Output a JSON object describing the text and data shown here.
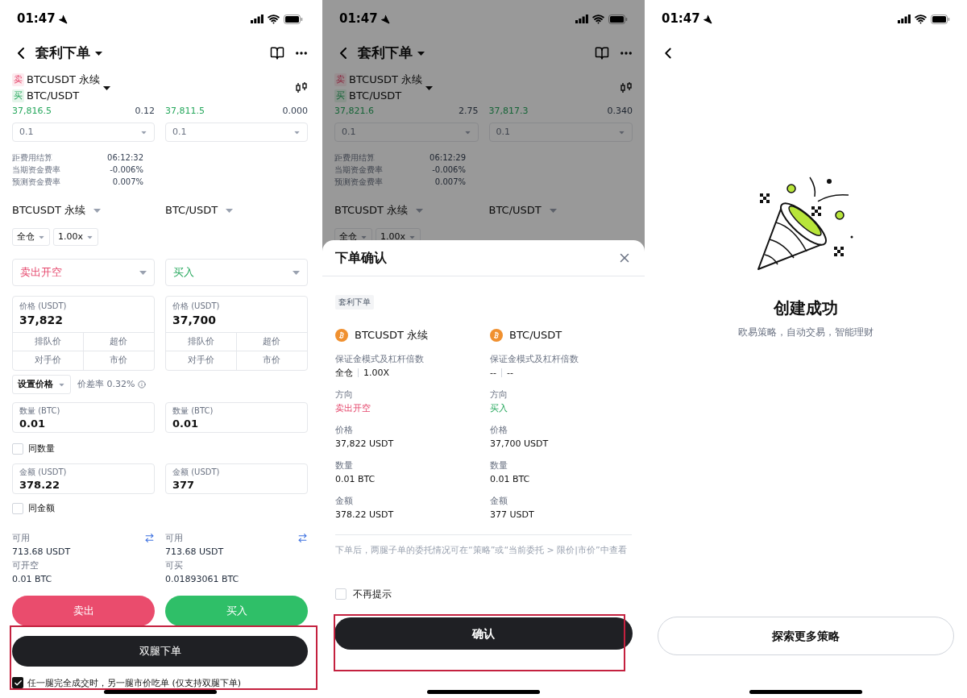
{
  "screens": [
    {
      "kind": "order",
      "time": "01:47",
      "title": "套利下单",
      "pairs": [
        {
          "tag": "卖",
          "name": "BTCUSDT 永续",
          "kind": "sell"
        },
        {
          "tag": "买",
          "name": "BTC/USDT",
          "kind": "buy"
        }
      ],
      "book": [
        {
          "price": "37,816.5",
          "size": "0.12",
          "step": "0.1"
        },
        {
          "price": "37,811.5",
          "size": "0.000",
          "step": "0.1"
        }
      ],
      "funding": [
        {
          "label": "距费用结算",
          "value": "06:12:32"
        },
        {
          "label": "当期资金费率",
          "value": "-0.006%"
        },
        {
          "label": "预测资金费率",
          "value": "0.007%"
        }
      ],
      "instruments": [
        "BTCUSDT 永续",
        "BTC/USDT"
      ],
      "margin": {
        "mode": "全仓",
        "leverage": "1.00x"
      },
      "legs": [
        {
          "kind": "sell",
          "direction": "卖出开空",
          "price_label": "价格 (USDT)",
          "price": "37,822",
          "price_options": [
            "排队价",
            "超价",
            "对手价",
            "市价"
          ],
          "qty_label": "数量 (BTC)",
          "qty": "0.01",
          "amount_label": "金额 (USDT)",
          "amount": "378.22",
          "available_label": "可用",
          "available": "713.68 USDT",
          "max_label": "可开空",
          "max": "0.01 BTC",
          "button": "卖出"
        },
        {
          "kind": "buy",
          "direction": "买入",
          "price_label": "价格 (USDT)",
          "price": "37,700",
          "price_options": [
            "排队价",
            "超价",
            "对手价",
            "市价"
          ],
          "qty_label": "数量 (BTC)",
          "qty": "0.01",
          "amount_label": "金额 (USDT)",
          "amount": "377",
          "available_label": "可用",
          "available": "713.68 USDT",
          "max_label": "可买",
          "max": "0.01893061 BTC",
          "button": "买入"
        }
      ],
      "price_mode": "设置价格",
      "spread": "价差率 0.32%",
      "same_qty": {
        "label": "同数量",
        "checked": false
      },
      "same_amount": {
        "label": "同金额",
        "checked": false
      },
      "submit": "双腿下单",
      "auto_taker": {
        "label": "任一腿完全成交时，另一腿市价吃单 (仅支持双腿下单)",
        "checked": true
      }
    },
    {
      "kind": "confirm",
      "time": "01:47",
      "title": "套利下单",
      "pairs": [
        {
          "tag": "卖",
          "name": "BTCUSDT 永续",
          "kind": "sell"
        },
        {
          "tag": "买",
          "name": "BTC/USDT",
          "kind": "buy"
        }
      ],
      "book": [
        {
          "price": "37,821.6",
          "size": "2.75",
          "step": "0.1"
        },
        {
          "price": "37,817.3",
          "size": "0.340",
          "step": "0.1"
        }
      ],
      "funding": [
        {
          "label": "距费用结算",
          "value": "06:12:29"
        },
        {
          "label": "当期资金费率",
          "value": "-0.006%"
        },
        {
          "label": "预测资金费率",
          "value": "0.007%"
        }
      ],
      "instruments": [
        "BTCUSDT 永续",
        "BTC/USDT"
      ],
      "margin": {
        "mode": "全仓",
        "leverage": "1.00x"
      },
      "dialog": {
        "title": "下单确认",
        "tag": "套利下单",
        "legs": [
          {
            "name": "BTCUSDT 永续",
            "kind": "sell",
            "fields": [
              {
                "kind": "pair",
                "label": "保证金模式及杠杆倍数",
                "values": [
                  "全仓",
                  "1.00X"
                ]
              },
              {
                "kind": "direction",
                "label": "方向",
                "value": "卖出开空"
              },
              {
                "kind": "text",
                "label": "价格",
                "value": "37,822 USDT"
              },
              {
                "kind": "text",
                "label": "数量",
                "value": "0.01 BTC"
              },
              {
                "kind": "text",
                "label": "金额",
                "value": "378.22 USDT"
              }
            ]
          },
          {
            "name": "BTC/USDT",
            "kind": "buy",
            "fields": [
              {
                "kind": "pair",
                "label": "保证金模式及杠杆倍数",
                "values": [
                  "--",
                  "--"
                ]
              },
              {
                "kind": "direction",
                "label": "方向",
                "value": "买入"
              },
              {
                "kind": "text",
                "label": "价格",
                "value": "37,700 USDT"
              },
              {
                "kind": "text",
                "label": "数量",
                "value": "0.01 BTC"
              },
              {
                "kind": "text",
                "label": "金额",
                "value": "377 USDT"
              }
            ]
          }
        ],
        "note": "下单后，两腿子单的委托情况可在“策略”或“当前委托 > 限价|市价”中查看",
        "dont_remind": {
          "label": "不再提示",
          "checked": false
        },
        "confirm": "确认"
      }
    },
    {
      "kind": "success",
      "time": "01:47",
      "title": "创建成功",
      "subtitle": "欧易策略，自动交易，智能理财",
      "button": "探索更多策略"
    }
  ]
}
